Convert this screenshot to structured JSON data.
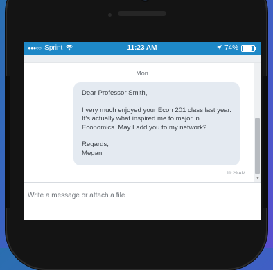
{
  "status_bar": {
    "signal": "●●●○○",
    "carrier": "Sprint",
    "wifi_icon": "wifi-icon",
    "time": "11:23 AM",
    "location_icon": "location-arrow-icon",
    "battery": "74%"
  },
  "chat": {
    "day_label": "Mon",
    "message": {
      "greeting": "Dear Professor Smith,",
      "body": "I very much enjoyed your Econ 201 class last year. It's actually what inspired me to major in Economics. May I add you to my network?",
      "closing": "Regards,",
      "signature": "Megan"
    },
    "timestamp": "11:29 AM"
  },
  "composer": {
    "placeholder": "Write a message or attach a file"
  },
  "colors": {
    "status_bar": "#1e88c7",
    "bubble": "#e4eaf1",
    "background_gradient_start": "#2a6fb0",
    "background_gradient_end": "#5a4fd0"
  }
}
